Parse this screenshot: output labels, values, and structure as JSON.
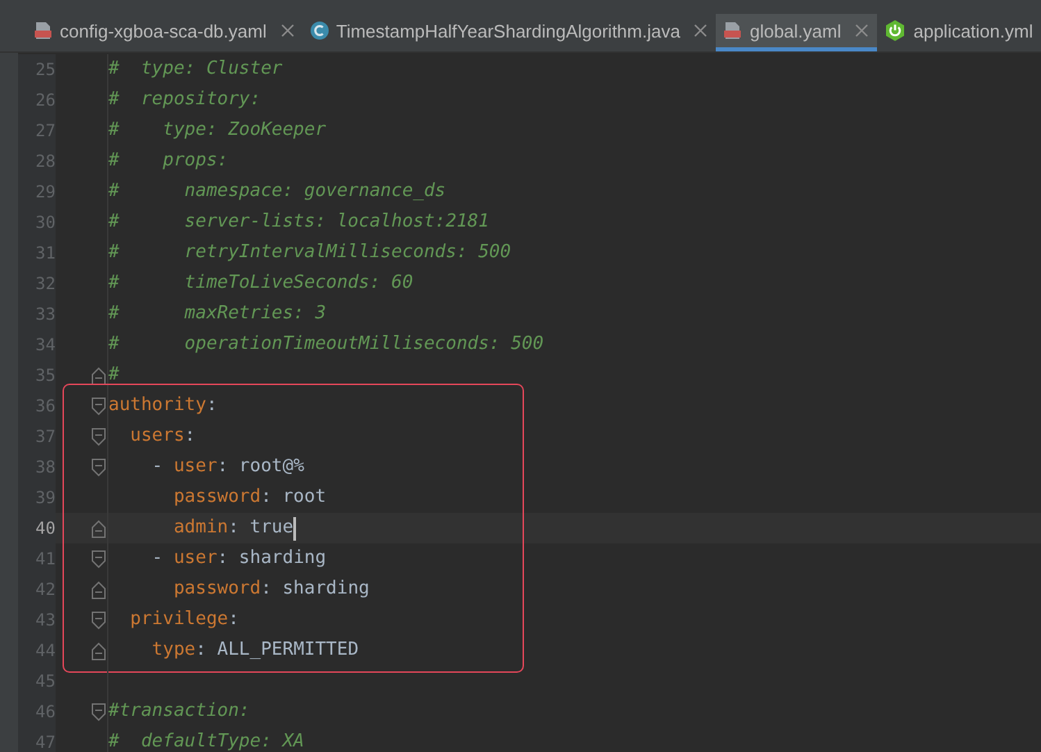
{
  "tabs": [
    {
      "label": "config-xgboa-sca-db.yaml",
      "kind": "yaml",
      "selected": false,
      "closable": true
    },
    {
      "label": "TimestampHalfYearShardingAlgorithm.java",
      "kind": "java",
      "selected": false,
      "closable": true
    },
    {
      "label": "global.yaml",
      "kind": "yaml",
      "selected": true,
      "closable": true
    },
    {
      "label": "application.yml",
      "kind": "spring",
      "selected": false
    }
  ],
  "editor": {
    "blocks": [
      {
        "kind": "plain",
        "lines": [
          {
            "number": "25",
            "tokens": [
              {
                "kind": "comment",
                "text": "#  type: Cluster"
              }
            ]
          },
          {
            "number": "26",
            "tokens": [
              {
                "kind": "comment",
                "text": "#  repository:"
              }
            ]
          },
          {
            "number": "27",
            "tokens": [
              {
                "kind": "comment",
                "text": "#    type: ZooKeeper"
              }
            ]
          },
          {
            "number": "28",
            "tokens": [
              {
                "kind": "comment",
                "text": "#    props:"
              }
            ]
          },
          {
            "number": "29",
            "tokens": [
              {
                "kind": "comment",
                "text": "#      namespace: governance_ds"
              }
            ]
          },
          {
            "number": "30",
            "tokens": [
              {
                "kind": "comment",
                "text": "#      server-lists: localhost:2181"
              }
            ]
          },
          {
            "number": "31",
            "tokens": [
              {
                "kind": "comment",
                "text": "#      retryIntervalMilliseconds: 500"
              }
            ]
          },
          {
            "number": "32",
            "tokens": [
              {
                "kind": "comment",
                "text": "#      timeToLiveSeconds: 60"
              }
            ]
          },
          {
            "number": "33",
            "tokens": [
              {
                "kind": "comment",
                "text": "#      maxRetries: 3"
              }
            ]
          },
          {
            "number": "34",
            "tokens": [
              {
                "kind": "comment",
                "text": "#      operationTimeoutMilliseconds: 500"
              }
            ]
          },
          {
            "number": "35",
            "fold_open": false,
            "tokens": [
              {
                "kind": "comment",
                "text": "#"
              }
            ]
          }
        ]
      },
      {
        "kind": "boxed",
        "lines": [
          {
            "number": "36",
            "fold_open": true,
            "tokens": [
              {
                "kind": "key",
                "text": "authority"
              },
              {
                "kind": "text",
                "text": ":"
              }
            ]
          },
          {
            "number": "37",
            "fold_open": true,
            "tokens": [
              {
                "kind": "key",
                "text": "  users"
              },
              {
                "kind": "text",
                "text": ":"
              }
            ]
          },
          {
            "number": "38",
            "fold_open": true,
            "tokens": [
              {
                "kind": "text",
                "text": "    - "
              },
              {
                "kind": "key",
                "text": "user"
              },
              {
                "kind": "text",
                "text": ": root@%"
              }
            ]
          },
          {
            "number": "39",
            "tokens": [
              {
                "kind": "key",
                "text": "      password"
              },
              {
                "kind": "text",
                "text": ": root"
              }
            ]
          },
          {
            "number": "40",
            "current": true,
            "fold_open": false,
            "tokens": [
              {
                "kind": "key",
                "text": "      admin"
              },
              {
                "kind": "text",
                "text": ": true"
              }
            ]
          },
          {
            "number": "41",
            "fold_open": true,
            "tokens": [
              {
                "kind": "text",
                "text": "    - "
              },
              {
                "kind": "key",
                "text": "user"
              },
              {
                "kind": "text",
                "text": ": sharding"
              }
            ]
          },
          {
            "number": "42",
            "fold_open": false,
            "tokens": [
              {
                "kind": "key",
                "text": "      password"
              },
              {
                "kind": "text",
                "text": ": sharding"
              }
            ]
          },
          {
            "number": "43",
            "fold_open": true,
            "tokens": [
              {
                "kind": "key",
                "text": "  privilege"
              },
              {
                "kind": "text",
                "text": ":"
              }
            ]
          },
          {
            "number": "44",
            "fold_open": false,
            "tokens": [
              {
                "kind": "key",
                "text": "    type"
              },
              {
                "kind": "text",
                "text": ": ALL_PERMITTED"
              }
            ]
          }
        ]
      },
      {
        "kind": "plain",
        "lines": [
          {
            "number": "45"
          },
          {
            "number": "46",
            "fold_open": true,
            "tokens": [
              {
                "kind": "comment",
                "text": "#transaction:"
              }
            ]
          },
          {
            "number": "47",
            "tokens": [
              {
                "kind": "comment",
                "text": "#  defaultType: XA"
              }
            ]
          }
        ]
      }
    ]
  }
}
